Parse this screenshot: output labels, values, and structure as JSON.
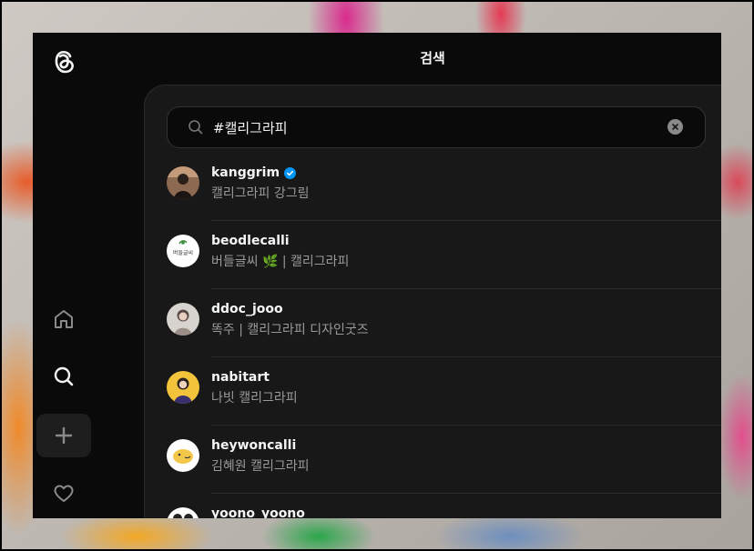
{
  "page": {
    "title": "검색"
  },
  "search": {
    "value": "#캘리그라피"
  },
  "results": [
    {
      "username": "kanggrim",
      "verified": true,
      "bio": "캘리그라피 강그림"
    },
    {
      "username": "beodlecalli",
      "verified": false,
      "bio": "버들글씨 🌿 | 캘리그라피",
      "avatar_text": "버들글씨"
    },
    {
      "username": "ddoc_jooo",
      "verified": false,
      "bio": "똑주 | 캘리그라피 디자인굿즈"
    },
    {
      "username": "nabitart",
      "verified": false,
      "bio": "나빗 캘리그라피"
    },
    {
      "username": "heywoncalli",
      "verified": false,
      "bio": "김혜원 캘리그라피"
    },
    {
      "username": "yoono_yoono",
      "verified": false,
      "bio": ""
    }
  ],
  "colors": {
    "accent_verified": "#0095f6",
    "panel": "#181818",
    "app_bg": "#0a0a0a"
  },
  "nav": {
    "icons": [
      "threads-logo-icon",
      "home-icon",
      "search-icon",
      "create-plus-icon",
      "heart-icon"
    ],
    "active": "search-icon"
  }
}
